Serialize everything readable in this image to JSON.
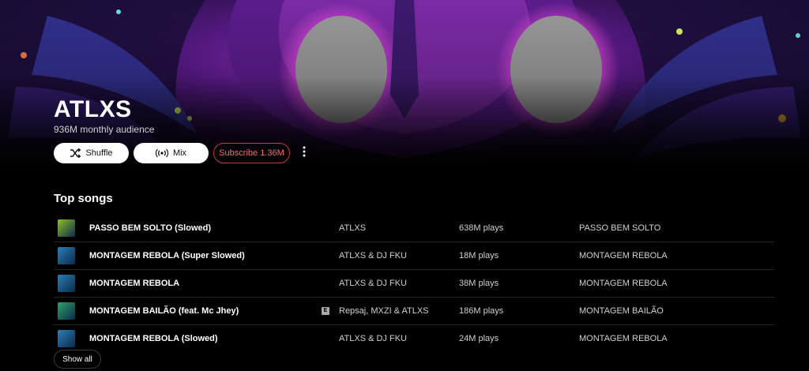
{
  "artist": {
    "name": "ATLXS",
    "audience": "936M monthly audience"
  },
  "actions": {
    "shuffle_label": "Shuffle",
    "shuffle_icon": "shuffle-icon",
    "mix_label": "Mix",
    "mix_icon": "radio-icon",
    "subscribe_label": "Subscribe 1.36M",
    "more_icon": "more-vert-icon"
  },
  "top_songs": {
    "title": "Top songs",
    "show_all_label": "Show all",
    "songs": [
      {
        "title": "PASSO BEM SOLTO (Slowed)",
        "artist": "ATLXS",
        "plays": "638M plays",
        "album": "PASSO BEM SOLTO",
        "explicit": false,
        "thumb_color": "#8fbf2a"
      },
      {
        "title": "MONTAGEM REBOLA (Super Slowed)",
        "artist": "ATLXS & DJ FKU",
        "plays": "18M plays",
        "album": "MONTAGEM REBOLA",
        "explicit": false,
        "thumb_color": "#2b7fb8"
      },
      {
        "title": "MONTAGEM REBOLA",
        "artist": "ATLXS & DJ FKU",
        "plays": "38M plays",
        "album": "MONTAGEM REBOLA",
        "explicit": false,
        "thumb_color": "#2b7fb8"
      },
      {
        "title": "MONTAGEM BAILÃO (feat. Mc Jhey)",
        "artist": "Repsaj, MXZI & ATLXS",
        "plays": "186M plays",
        "album": "MONTAGEM BAILÃO",
        "explicit": true,
        "explicit_label": "E",
        "thumb_color": "#2fa36a"
      },
      {
        "title": "MONTAGEM REBOLA (Slowed)",
        "artist": "ATLXS & DJ FKU",
        "plays": "24M plays",
        "album": "MONTAGEM REBOLA",
        "explicit": false,
        "thumb_color": "#2b7fb8"
      }
    ]
  },
  "colors": {
    "background": "#000000",
    "subscribe_accent": "#ff6b6b",
    "hero_purple": "#8a2be2",
    "hero_magenta": "#c02a9a"
  }
}
